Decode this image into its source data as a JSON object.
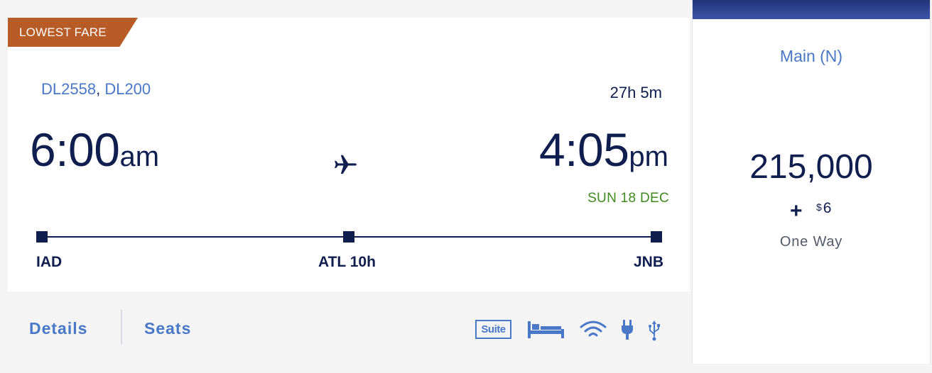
{
  "badge": {
    "label": "LOWEST FARE"
  },
  "flight": {
    "number1": "DL2558",
    "separator": ",",
    "number2": "DL200",
    "duration": "27h 5m"
  },
  "departure": {
    "time": "6:00",
    "ampm": "am",
    "airport": "IAD"
  },
  "arrival": {
    "time": "4:05",
    "ampm": "pm",
    "date": "SUN 18 DEC",
    "airport": "JNB"
  },
  "connection": {
    "label": "ATL 10h"
  },
  "actions": {
    "details": "Details",
    "seats": "Seats"
  },
  "amenities": {
    "suite": "Suite",
    "icons": [
      "suite-icon",
      "flat-bed-icon",
      "wifi-icon",
      "power-plug-icon",
      "usb-icon"
    ]
  },
  "fare": {
    "cabin": "Main (N)",
    "miles": "215,000",
    "plus": "+",
    "currency": "$",
    "cash": "6",
    "trip_type": "One Way"
  },
  "colors": {
    "navy": "#0f1d4f",
    "link_blue": "#4a78c8",
    "badge_orange": "#b85c27",
    "date_green": "#3f8a1f"
  }
}
